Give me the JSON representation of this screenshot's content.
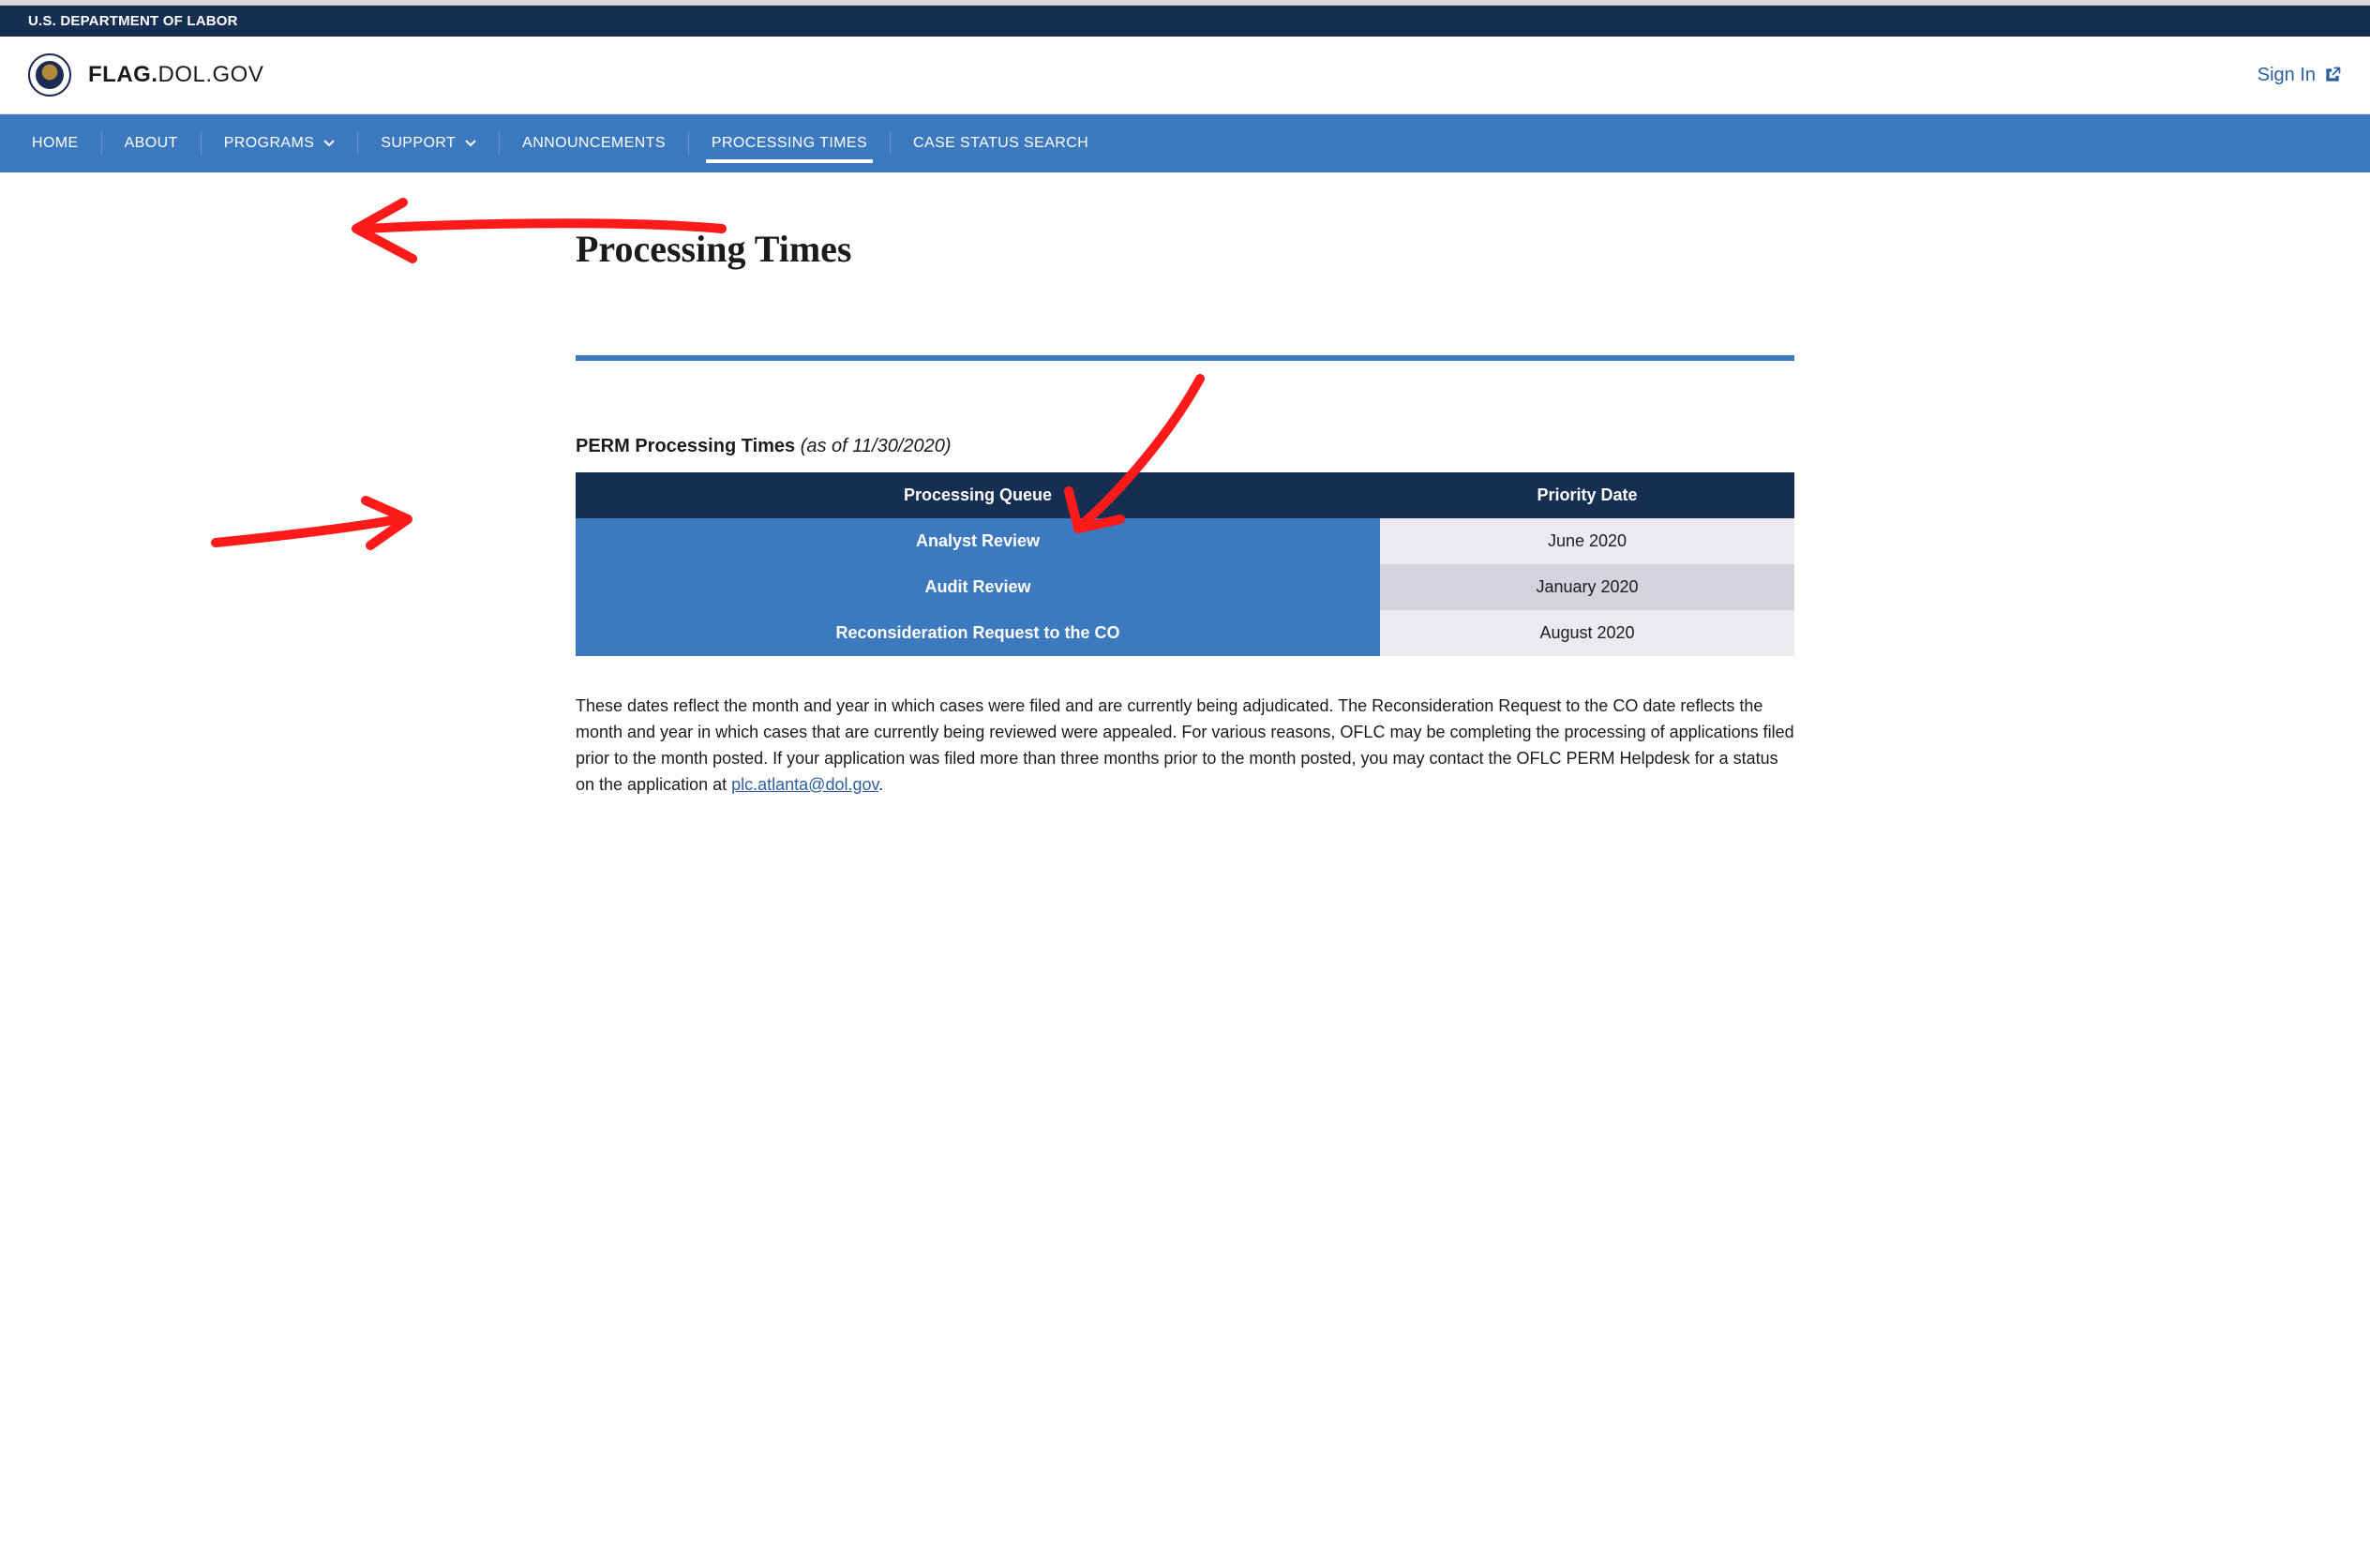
{
  "gov_banner": "U.S. DEPARTMENT OF LABOR",
  "brand": {
    "flag": "FLAG.",
    "rest": "DOL.GOV"
  },
  "sign_in": "Sign In",
  "nav": {
    "home": "HOME",
    "about": "ABOUT",
    "programs": "PROGRAMS",
    "support": "SUPPORT",
    "announcements": "ANNOUNCEMENTS",
    "processing_times": "PROCESSING TIMES",
    "case_status_search": "CASE STATUS SEARCH"
  },
  "page_title": "Processing Times",
  "section": {
    "label": "PERM Processing Times ",
    "asof": "(as of 11/30/2020)"
  },
  "table": {
    "head": {
      "queue": "Processing Queue",
      "date": "Priority Date"
    },
    "rows": [
      {
        "queue": "Analyst Review",
        "date": "June 2020"
      },
      {
        "queue": "Audit Review",
        "date": "January 2020"
      },
      {
        "queue": "Reconsideration Request to the CO",
        "date": "August 2020"
      }
    ]
  },
  "note_text": "These dates reflect the month and year in which cases were filed and are currently being adjudicated. The Reconsideration Request to the CO date reflects the month and year in which cases that are currently being reviewed were appealed. For various reasons, OFLC may be completing the processing of applications filed prior to the month posted. If your application was filed more than three months prior to the month posted, you may contact the OFLC PERM Helpdesk for a status on the application at ",
  "note_link": "plc.atlanta@dol.gov",
  "note_tail": "."
}
